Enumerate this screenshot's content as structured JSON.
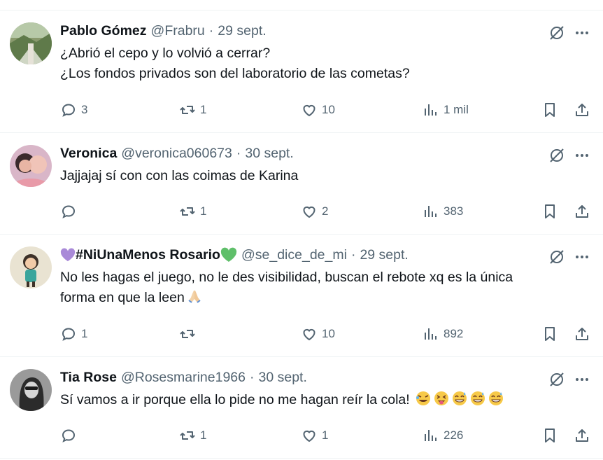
{
  "tweets": [
    {
      "name": "Pablo Gómez",
      "handle": "@Frabru",
      "date": "29 sept.",
      "lines": [
        "¿Abrió el cepo y lo volvió a cerrar?",
        "¿Los fondos privados son del laboratorio de las cometas?"
      ],
      "replies": "3",
      "retweets": "1",
      "likes": "10",
      "views": "1 mil",
      "avatar_icon": "landscape-photo-avatar"
    },
    {
      "name": "Veronica",
      "handle": "@veronica060673",
      "date": "30 sept.",
      "lines": [
        "Jajjajaj sí con con las coimas de Karina"
      ],
      "replies": "",
      "retweets": "1",
      "likes": "2",
      "views": "383",
      "avatar_icon": "portrait-photo-avatar"
    },
    {
      "name": "#NiUnaMenos Rosario",
      "name_emoji_left": "purple-heart",
      "name_emoji_right": "green-heart",
      "handle": "@se_dice_de_mi",
      "date": "29 sept.",
      "lines": [
        "No les hagas el juego, no le des visibilidad, buscan el rebote xq es la única",
        "forma en que la leen"
      ],
      "body_emoji": [
        "folded-hands"
      ],
      "replies": "1",
      "retweets": "",
      "likes": "10",
      "views": "892",
      "avatar_icon": "cartoon-avatar"
    },
    {
      "name": "Tia Rose",
      "handle": "@Rosesmarine1966",
      "date": "30 sept.",
      "lines": [
        "Sí vamos a ir porque ella lo pide no me hagan reír la cola!"
      ],
      "body_emoji": [
        "rolling-laughing",
        "squinting-tongue",
        "grinning-sweat",
        "grinning-sweat",
        "grinning-sweat"
      ],
      "replies": "",
      "retweets": "1",
      "likes": "1",
      "views": "226",
      "avatar_icon": "bw-portrait-avatar"
    }
  ],
  "separator": "·",
  "colors": {
    "text": "#0f1419",
    "muted": "#536471",
    "divider": "#eff3f4"
  }
}
